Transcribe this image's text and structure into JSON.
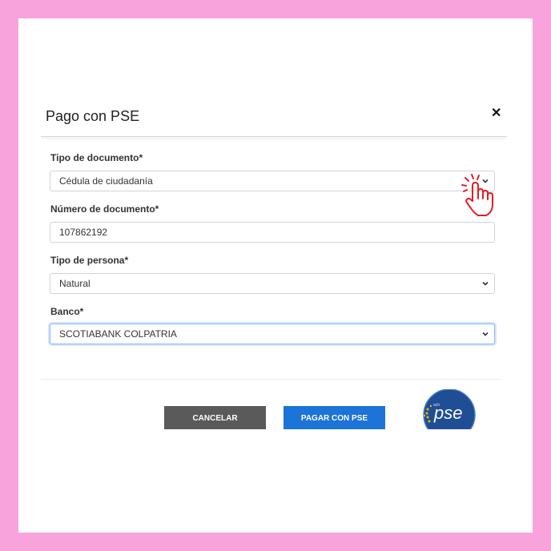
{
  "dialog": {
    "title": "Pago con PSE",
    "close_icon": "close-icon"
  },
  "form": {
    "document_type": {
      "label": "Tipo de documento*",
      "value": "Cédula de ciudadanía"
    },
    "document_number": {
      "label": "Número de documento*",
      "value": "107862192"
    },
    "person_type": {
      "label": "Tipo de persona*",
      "value": "Natural"
    },
    "bank": {
      "label": "Banco*",
      "value": "SCOTIABANK COLPATRIA"
    }
  },
  "buttons": {
    "cancel_label": "CANCELAR",
    "pay_label": "PAGAR CON PSE"
  },
  "logo": {
    "text": "pse",
    "small_text": "ach"
  },
  "icons": [
    "close-icon",
    "chevron-down-icon",
    "pointing-hand-icon",
    "pse-logo"
  ],
  "colors": {
    "background_frame": "#f9a3dd",
    "cancel_button": "#5a5a5a",
    "pay_button": "#1c73d8",
    "focus_border": "#86b7fe",
    "hand_icon": "#e31e24"
  }
}
